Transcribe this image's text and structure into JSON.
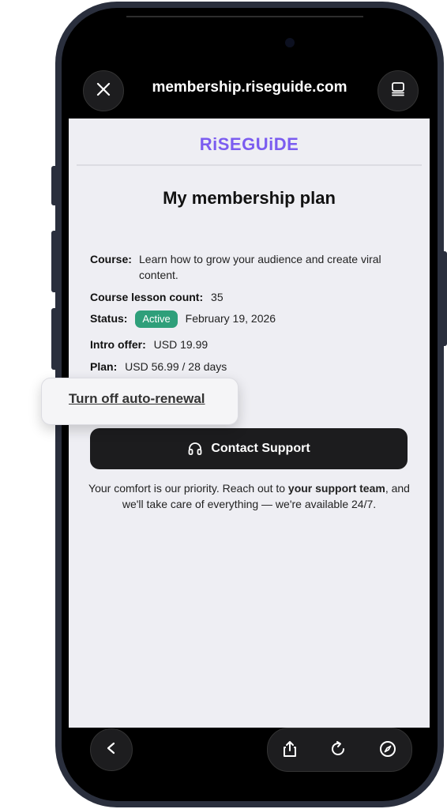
{
  "browser": {
    "url": "membership.riseguide.com"
  },
  "brand": {
    "logo": "RiSEGUiDE",
    "accent_color": "#7b5cf0"
  },
  "page": {
    "title": "My membership plan",
    "course_label": "Course:",
    "course_value": "Learn how to grow your audience and create viral content.",
    "lesson_label": "Course lesson count:",
    "lesson_value": "35",
    "status_label": "Status:",
    "status_badge": "Active",
    "status_date": "February 19, 2026",
    "intro_label": "Intro offer:",
    "intro_value": "USD 19.99",
    "plan_label": "Plan:",
    "plan_value": "USD 56.99 / 28 days",
    "auto_renewal_link": "Turn off auto-renewal",
    "contact_button": "Contact Support",
    "comfort_pre": "Your comfort is our priority. Reach out to ",
    "comfort_bold": "your support team",
    "comfort_post": ", and we'll take care of everything — we're available 24/7."
  },
  "colors": {
    "badge_active": "#2e9f7a",
    "button_dark": "#1c1c1e"
  }
}
